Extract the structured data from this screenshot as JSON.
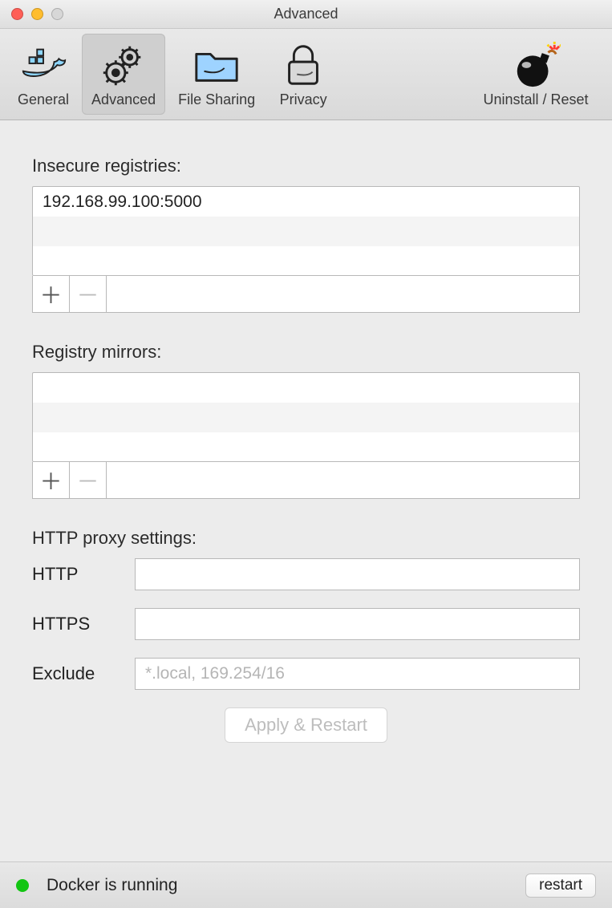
{
  "window": {
    "title": "Advanced"
  },
  "toolbar": {
    "items": [
      {
        "label": "General"
      },
      {
        "label": "Advanced"
      },
      {
        "label": "File Sharing"
      },
      {
        "label": "Privacy"
      },
      {
        "label": "Uninstall / Reset"
      }
    ]
  },
  "sections": {
    "insecure_label": "Insecure registries:",
    "insecure_items": [
      "192.168.99.100:5000"
    ],
    "mirrors_label": "Registry mirrors:",
    "mirrors_items": [],
    "proxy_heading": "HTTP proxy settings:",
    "proxy": {
      "http_label": "HTTP",
      "http_value": "",
      "https_label": "HTTPS",
      "https_value": "",
      "exclude_label": "Exclude",
      "exclude_value": "",
      "exclude_placeholder": "*.local, 169.254/16"
    }
  },
  "buttons": {
    "add": "＋",
    "remove": "－",
    "apply": "Apply & Restart",
    "restart": "restart"
  },
  "status": {
    "text": "Docker is running",
    "color": "#12c512"
  }
}
